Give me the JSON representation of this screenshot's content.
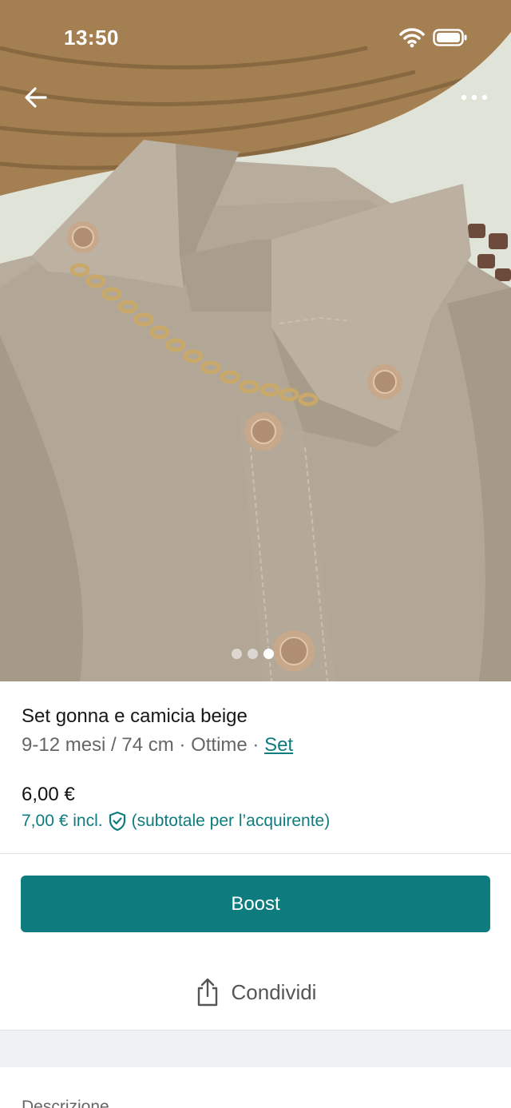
{
  "status_bar": {
    "time": "13:50",
    "wifi_icon": "wifi-icon",
    "battery_icon": "battery-icon"
  },
  "header": {
    "back_icon": "arrow-left-icon",
    "more_icon": "more-horizontal-icon"
  },
  "gallery": {
    "image_count": 3,
    "active_index": 3
  },
  "item": {
    "title": "Set gonna e camicia beige",
    "size": "9-12 mesi / 74 cm",
    "sep1": " · ",
    "condition": "Ottime",
    "sep2": " · ",
    "category_link": "Set",
    "price": "6,00 €",
    "price_incl_amount": "7,00 € incl.",
    "price_incl_note": "(subtotale per l’acquirente)"
  },
  "actions": {
    "boost_label": "Boost",
    "share_label": "Condividi",
    "share_icon": "share-icon"
  },
  "description": {
    "heading": "Descrizione"
  },
  "colors": {
    "accent": "#0e7c7e",
    "text_primary": "#171717",
    "text_secondary": "#666666"
  }
}
